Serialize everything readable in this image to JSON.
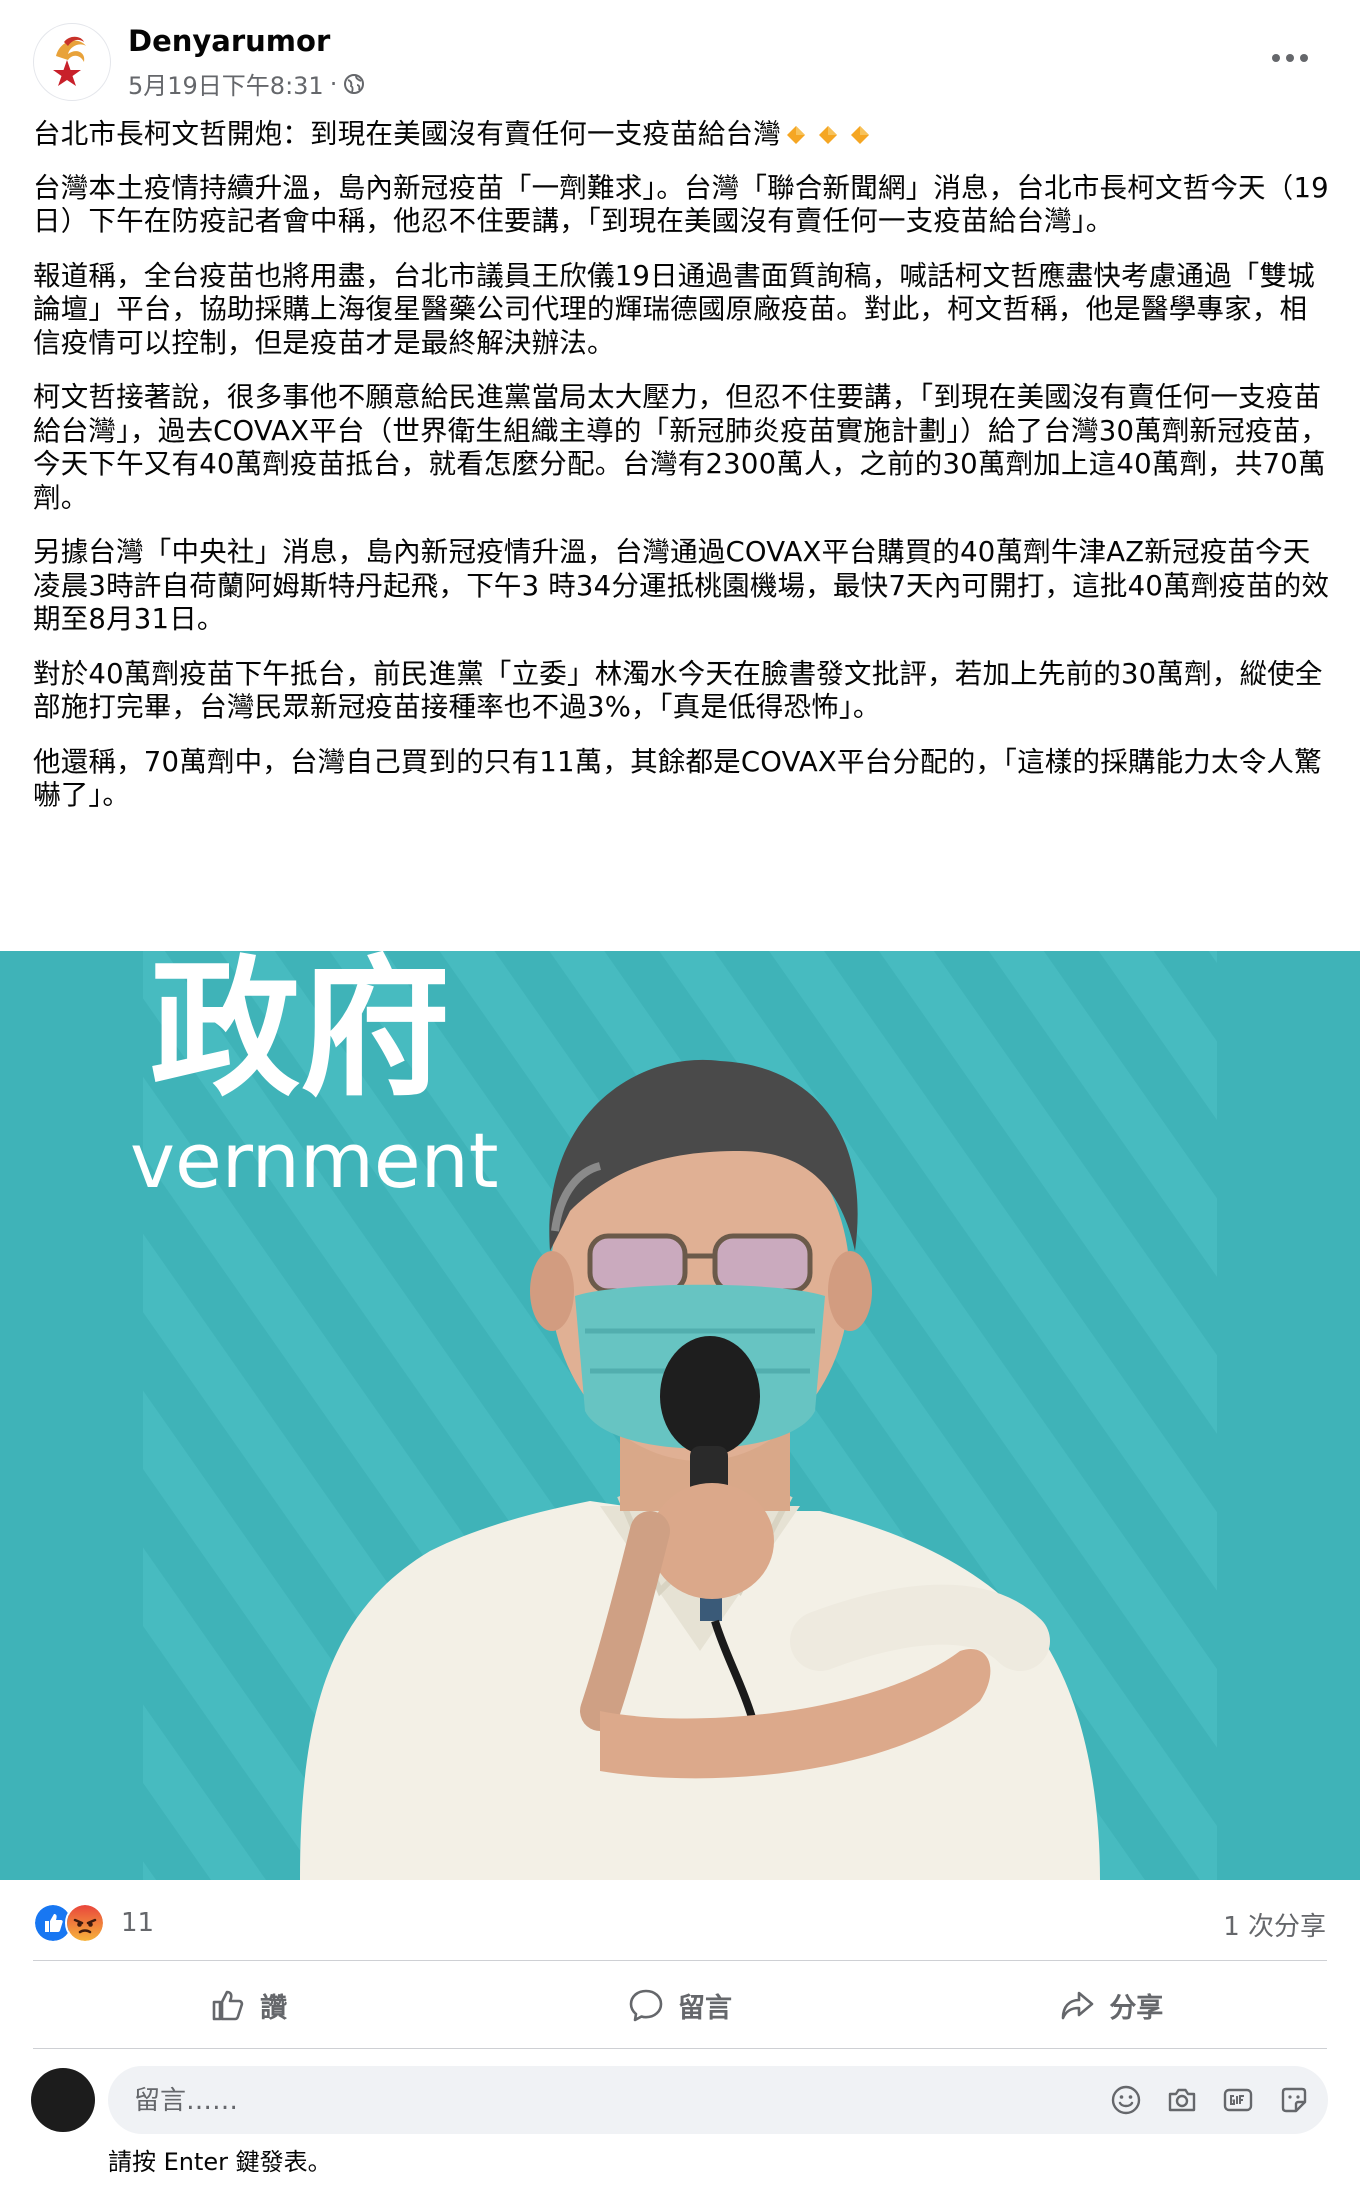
{
  "post": {
    "author": "Denyarumor",
    "timestamp": "5月19日下午8:31",
    "meta_separator": "·",
    "privacy_icon": "globe-icon",
    "more_icon": "more-horizontal-icon"
  },
  "body": {
    "headline": "台北市長柯文哲開炮：到現在美國沒有賣任何一支疫苗給台灣",
    "headline_emoji": "small-orange-diamond-icon",
    "paragraphs": [
      "台灣本土疫情持續升溫，島內新冠疫苗「一劑難求」。台灣「聯合新聞網」消息，台北市長柯文哲今天（19日）下午在防疫記者會中稱，他忍不住要講，「到現在美國沒有賣任何一支疫苗給台灣」。",
      "報道稱，全台疫苗也將用盡，台北市議員王欣儀19日通過書面質詢稿，喊話柯文哲應盡快考慮通過「雙城論壇」平台，協助採購上海復星醫藥公司代理的輝瑞德國原廠疫苗。對此，柯文哲稱，他是醫學專家，相信疫情可以控制，但是疫苗才是最終解決辦法。",
      "柯文哲接著說，很多事他不願意給民進黨當局太大壓力，但忍不住要講，「到現在美國沒有賣任何一支疫苗給台灣」，過去COVAX平台（世界衛生組織主導的「新冠肺炎疫苗實施計劃」）給了台灣30萬劑新冠疫苗，今天下午又有40萬劑疫苗抵台，就看怎麼分配。台灣有2300萬人，之前的30萬劑加上這40萬劑，共70萬劑。",
      "另據台灣「中央社」消息，島內新冠疫情升溫，台灣通過COVAX平台購買的40萬劑牛津AZ新冠疫苗今天凌晨3時許自荷蘭阿姆斯特丹起飛，下午3 時34分運抵桃園機場，最快7天內可開打，這批40萬劑疫苗的效期至8月31日。",
      "對於40萬劑疫苗下午抵台，前民進黨「立委」林濁水今天在臉書發文批評，若加上先前的30萬劑，縱使全部施打完畢，台灣民眾新冠疫苗接種率也不過3%，「真是低得恐怖」。",
      "他還稱，70萬劑中，台灣自己買到的只有11萬，其餘都是COVAX平台分配的，「這樣的採購能力太令人驚嚇了」。"
    ]
  },
  "photo": {
    "backdrop_text_cn": "政府",
    "backdrop_text_en": "vernment",
    "backdrop_color": "#3fb3b8"
  },
  "engagement": {
    "reaction_icons": [
      "like-reaction-icon",
      "angry-reaction-icon"
    ],
    "reaction_count": "11",
    "share_count": "1 次分享"
  },
  "actions": {
    "like_label": "讚",
    "comment_label": "留言",
    "share_label": "分享"
  },
  "composer": {
    "placeholder": "留言……",
    "hint": "請按 Enter 鍵發表。",
    "tools": [
      "emoji-icon",
      "camera-icon",
      "gif-icon",
      "sticker-icon"
    ]
  },
  "colors": {
    "text_primary": "#050505",
    "text_secondary": "#65676b",
    "divider": "#ced0d4",
    "like_blue": "#1877f2",
    "angry_orange": "#f0663f",
    "composer_bg": "#f0f2f5"
  }
}
